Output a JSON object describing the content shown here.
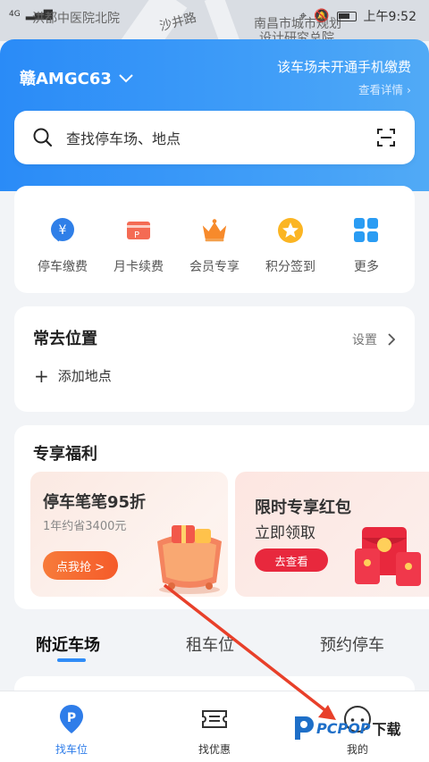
{
  "status_bar": {
    "signal": "4G",
    "map_labels": [
      "洪都中医院北院",
      "沙井路",
      "南昌市城市规划",
      "设计研究总院"
    ],
    "time": "上午9:52"
  },
  "header": {
    "plate": "赣AMGC63",
    "notice": "该车场未开通手机缴费",
    "detail_link": "查看详情"
  },
  "search": {
    "placeholder": "查找停车场、地点"
  },
  "services": [
    {
      "label": "停车缴费",
      "icon": "yuan-bubble-icon",
      "color": "#2f7fe8"
    },
    {
      "label": "月卡续费",
      "icon": "card-icon",
      "color": "#f46b54"
    },
    {
      "label": "会员专享",
      "icon": "crown-icon",
      "color": "#f78a2b"
    },
    {
      "label": "积分签到",
      "icon": "star-badge-icon",
      "color": "#fbb523"
    },
    {
      "label": "更多",
      "icon": "grid-icon",
      "color": "#2a9cf3"
    }
  ],
  "frequent": {
    "title": "常去位置",
    "settings": "设置",
    "add": "添加地点"
  },
  "benefits": {
    "title": "专享福利",
    "promo1": {
      "headline": "停车笔笔95折",
      "sub": "1年约省3400元",
      "button": "点我抢 >"
    },
    "promo2": {
      "headline": "限时专享红包",
      "sub": "立即领取",
      "button": "去查看"
    }
  },
  "tabs": [
    "附近车场",
    "租车位",
    "预约停车"
  ],
  "bottom_nav": [
    {
      "label": "找车位"
    },
    {
      "label": "找优惠"
    },
    {
      "label": "我的"
    }
  ],
  "watermark": {
    "brand": "PCPOP",
    "suffix": "下载"
  }
}
